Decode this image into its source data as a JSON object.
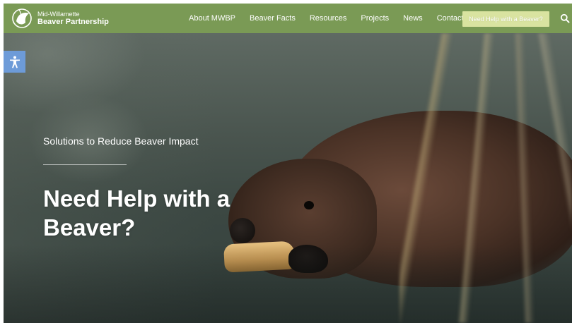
{
  "header": {
    "logo_line1": "Mid-Willamette",
    "logo_line2": "Beaver Partnership",
    "nav": [
      {
        "label": "About MWBP"
      },
      {
        "label": "Beaver Facts"
      },
      {
        "label": "Resources"
      },
      {
        "label": "Projects"
      },
      {
        "label": "News"
      },
      {
        "label": "Contact"
      }
    ],
    "cta_label": "Need Help with a Beaver?",
    "search_icon": "search-icon"
  },
  "hero": {
    "subtitle": "Solutions to Reduce Beaver Impact",
    "headline": "Need Help with a Beaver?",
    "accessibility_icon": "accessibility-icon"
  },
  "colors": {
    "header_bg": "#7a9a55",
    "cta_bg": "#d9e3a0",
    "accessibility_bg": "#6d9bd8"
  }
}
